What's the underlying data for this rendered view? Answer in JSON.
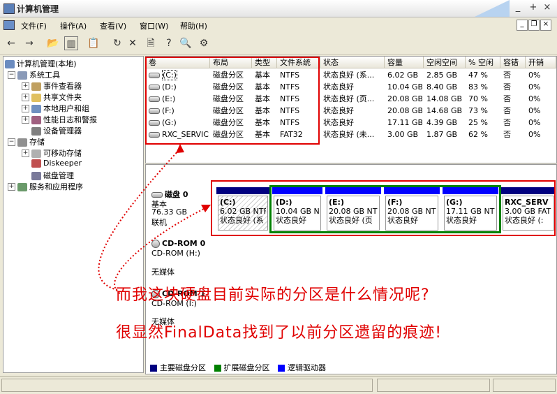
{
  "window": {
    "title": "计算机管理",
    "btn_min": "_",
    "btn_max": "+",
    "btn_close": "×"
  },
  "menu": [
    "文件(F)",
    "操作(A)",
    "查看(V)",
    "窗口(W)",
    "帮助(H)"
  ],
  "tree": {
    "root": "计算机管理(本地)",
    "system_tools": "系统工具",
    "event_viewer": "事件查看器",
    "shared_folders": "共享文件夹",
    "local_users": "本地用户和组",
    "perf_logs": "性能日志和警报",
    "device_manager": "设备管理器",
    "storage": "存储",
    "removable": "可移动存储",
    "diskeeper": "Diskeeper",
    "disk_mgmt": "磁盘管理",
    "services": "服务和应用程序"
  },
  "volume_table": {
    "headers": [
      "卷",
      "布局",
      "类型",
      "文件系统",
      "状态",
      "容量",
      "空闲空间",
      "% 空闲",
      "容错",
      "开销"
    ],
    "rows": [
      [
        "(C:)",
        "磁盘分区",
        "基本",
        "NTFS",
        "状态良好 (系...",
        "6.02 GB",
        "2.85 GB",
        "47 %",
        "否",
        "0%"
      ],
      [
        "(D:)",
        "磁盘分区",
        "基本",
        "NTFS",
        "状态良好",
        "10.04 GB",
        "8.40 GB",
        "83 %",
        "否",
        "0%"
      ],
      [
        "(E:)",
        "磁盘分区",
        "基本",
        "NTFS",
        "状态良好 (页...",
        "20.08 GB",
        "14.08 GB",
        "70 %",
        "否",
        "0%"
      ],
      [
        "(F:)",
        "磁盘分区",
        "基本",
        "NTFS",
        "状态良好",
        "20.08 GB",
        "14.68 GB",
        "73 %",
        "否",
        "0%"
      ],
      [
        "(G:)",
        "磁盘分区",
        "基本",
        "NTFS",
        "状态良好",
        "17.11 GB",
        "4.39 GB",
        "25 %",
        "否",
        "0%"
      ],
      [
        "RXC_SERVICE",
        "磁盘分区",
        "基本",
        "FAT32",
        "状态良好 (未...",
        "3.00 GB",
        "1.87 GB",
        "62 %",
        "否",
        "0%"
      ]
    ]
  },
  "disk0": {
    "name": "磁盘 0",
    "type": "基本",
    "size": "76.33 GB",
    "status": "联机",
    "partitions": [
      {
        "name": "(C:)",
        "size": "6.02 GB NTFS",
        "status": "状态良好 (系"
      },
      {
        "name": "(D:)",
        "size": "10.04 GB NT",
        "status": "状态良好"
      },
      {
        "name": "(E:)",
        "size": "20.08 GB NTFS",
        "status": "状态良好 (页"
      },
      {
        "name": "(F:)",
        "size": "20.08 GB NTFS",
        "status": "状态良好"
      },
      {
        "name": "(G:)",
        "size": "17.11 GB NTF",
        "status": "状态良好"
      },
      {
        "name": "RXC_SERV",
        "size": "3.00 GB FAT",
        "status": "状态良好 (:"
      }
    ]
  },
  "cdrom0": {
    "name": "CD-ROM 0",
    "sub": "CD-ROM (H:)",
    "media": "无媒体"
  },
  "cdrom1": {
    "name": "CD-ROM 1",
    "sub": "CD-ROM (I:)",
    "media": "无媒体"
  },
  "legend": [
    "主要磁盘分区",
    "扩展磁盘分区",
    "逻辑驱动器"
  ],
  "annotation": {
    "line1": "而我这块硬盘目前实际的分区是什么情况呢?",
    "line2": "很显然FinalData找到了以前分区遗留的痕迹!"
  },
  "colors": {
    "primary": "#000080",
    "extended": "#008000",
    "logical": "#0000ff",
    "highlight": "#e00000"
  }
}
